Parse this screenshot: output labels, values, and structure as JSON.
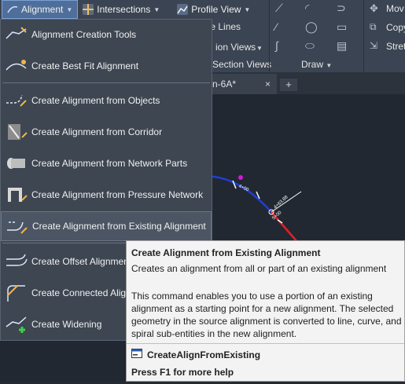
{
  "ribbon": {
    "alignment_label": "Alignment",
    "intersections_label": "Intersections",
    "profile_view_label": "Profile View",
    "sample_lines_label": "ple Lines",
    "section_views_label": "ion Views",
    "section_views_panel": "Section Views",
    "draw_panel": "Draw",
    "move_label": "Mov",
    "copy_label": "Copy",
    "stretch_label": "Stret"
  },
  "tabs": {
    "document_tab": "n-6A*",
    "close_glyph": "×",
    "new_tab_glyph": "+"
  },
  "menu": {
    "items": [
      {
        "label": "Alignment Creation Tools"
      },
      {
        "label": "Create Best Fit Alignment"
      },
      {
        "label": "Create Alignment from Objects"
      },
      {
        "label": "Create Alignment from Corridor"
      },
      {
        "label": "Create Alignment from Network Parts"
      },
      {
        "label": "Create Alignment from Pressure Network"
      },
      {
        "label": "Create Alignment from Existing Alignment"
      },
      {
        "label": "Create Offset Alignment"
      },
      {
        "label": "Create Connected Alignment"
      },
      {
        "label": "Create Widening"
      }
    ]
  },
  "canvas": {
    "station_label_1": "4+00",
    "station_label_2": "4+63.88",
    "station_label_3": "5+00"
  },
  "tooltip": {
    "title": "Create Alignment from Existing Alignment",
    "short": "Creates an alignment from all or part of an existing alignment",
    "description": "This command enables you to use a portion of an existing alignment as a starting point for a new alignment. The selected geometry in the source alignment is converted to line, curve, and spiral sub-entities in the new alignment.",
    "command": "CreateAlignFromExisting",
    "help": "Press F1 for more help"
  },
  "colors": {
    "ribbon_bg": "#3b4452",
    "menu_bg": "#3d4651",
    "highlight": "#4b5563",
    "alignment_blue": "#1f3fd6",
    "alignment_red": "#e0202a",
    "marker_magenta": "#d219d8",
    "tooltip_bg": "#f3f3f3"
  }
}
